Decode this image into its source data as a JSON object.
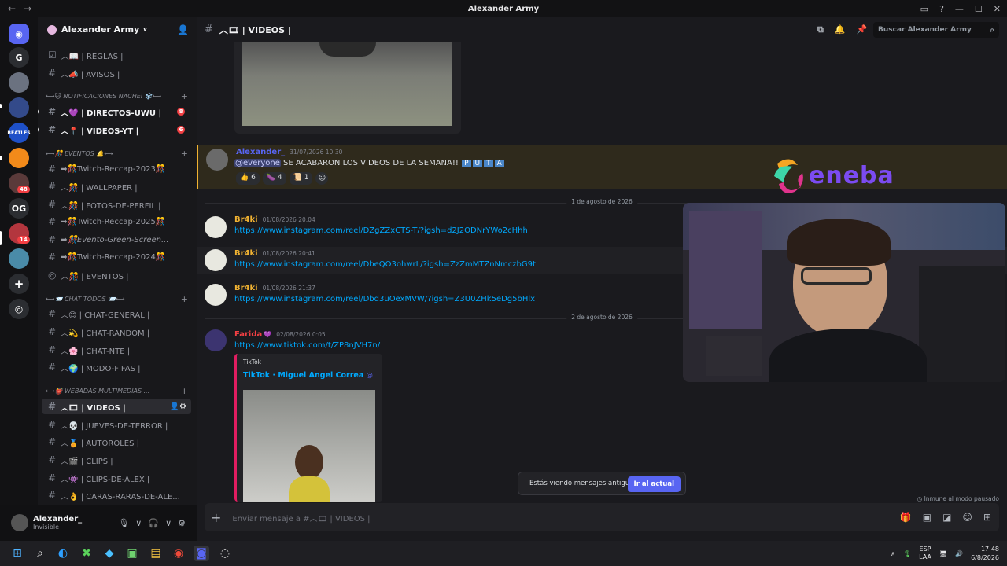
{
  "window": {
    "title": "Alexander Army"
  },
  "server": {
    "name": "Alexander Army"
  },
  "rail": {
    "servers": [
      {
        "name": "discord-home"
      },
      {
        "label": "G"
      },
      {
        "name": "server-a"
      },
      {
        "name": "server-b"
      },
      {
        "name": "beatles"
      },
      {
        "name": "server-c"
      },
      {
        "name": "server-d",
        "badge": "48"
      },
      {
        "label": "OG"
      },
      {
        "name": "server-e",
        "badge": "14"
      },
      {
        "name": "server-f"
      }
    ]
  },
  "sidebar": {
    "channels_top": [
      {
        "label": "︿📖 | REGLAS |"
      },
      {
        "label": "︿📣 | AVISOS |"
      }
    ],
    "cat_notif": "⟷🐱 NOTIFICACIONES NACHEI ❄️⟷",
    "notif_channels": [
      {
        "label": "︿💜 | DIRECTOS-UWU |",
        "mention": "8"
      },
      {
        "label": "︿📍 | VIDEOS-YT |",
        "mention": "6"
      }
    ],
    "cat_eventos": "⟷🎊 EVENTOS 🔔⟷",
    "eventos_channels": [
      {
        "label": "➡🎊Twitch-Reccap-2023🎊"
      },
      {
        "label": "︿🎊 | WALLPAPER |"
      },
      {
        "label": "︿🎊 | FOTOS-DE-PERFIL |"
      },
      {
        "label": "➡🎊Twitch-Reccap-2025🎊"
      },
      {
        "label": "➡🎊Evento-Green-Screen..."
      },
      {
        "label": "➡🎊Twitch-Reccap-2024🎊"
      },
      {
        "label": "︿🎊 | EVENTOS |"
      }
    ],
    "cat_chat": "⟷📨 CHAT TODOS 📨⟷",
    "chat_channels": [
      {
        "label": "︿😊 | CHAT-GENERAL |"
      },
      {
        "label": "︿💫 | CHAT-RANDOM |"
      },
      {
        "label": "︿🌸 | CHAT-NTE |"
      },
      {
        "label": "︿🌍 | MODO-FIFAS |"
      }
    ],
    "cat_webadas": "⟷👹 WEBADAS MULTIMEDIAS ...",
    "webadas_channels": [
      {
        "label": "︿🎞 | VIDEOS |"
      },
      {
        "label": "︿💀 | JUEVES-DE-TERROR |"
      },
      {
        "label": "︿🏅 | AUTOROLES |"
      },
      {
        "label": "︿🎬 | CLIPS |"
      },
      {
        "label": "︿👾 | CLIPS-DE-ALEX |"
      },
      {
        "label": "︿👌 | CARAS-RARAS-DE-ALE..."
      }
    ]
  },
  "user": {
    "name": "Alexander_",
    "status": "Invisible"
  },
  "channel": {
    "title": "︿🎞 | VIDEOS |"
  },
  "search": {
    "placeholder": "Buscar Alexander Army"
  },
  "messages": {
    "announce": {
      "author": "Alexander_",
      "time": "31/07/2026 10:30",
      "mention": "@everyone",
      "text": " SE ACABARON LOS VIDEOS DE LA SEMANA!!",
      "puta": [
        "P",
        "U",
        "T",
        "A"
      ],
      "reactions": [
        {
          "emoji": "👍",
          "count": "6"
        },
        {
          "emoji": "🍆",
          "count": "4"
        },
        {
          "emoji": "📜",
          "count": "1"
        }
      ]
    },
    "date1": "1 de agosto de 2026",
    "br1": {
      "author": "Br4ki",
      "time": "01/08/2026 20:04",
      "link": "https://www.instagram.com/reel/DZgZZxCTS-T/?igsh=d2J2ODNrYWo2cHhh"
    },
    "br2": {
      "author": "Br4ki",
      "time": "01/08/2026 20:41",
      "link": "https://www.instagram.com/reel/DbeQO3ohwrL/?igsh=ZzZmMTZnNmczbG9t"
    },
    "br3": {
      "author": "Br4ki",
      "time": "01/08/2026 21:37",
      "link": "https://www.instagram.com/reel/Dbd3uOexMVW/?igsh=Z3U0ZHk5eDg5bHlx"
    },
    "date2": "2 de agosto de 2026",
    "farida": {
      "author": "Farida",
      "time": "02/08/2026 0:05",
      "link": "https://www.tiktok.com/t/ZP8nJVH7n/",
      "embed_provider": "TikTok",
      "embed_title": "TikTok · Miguel Angel Correa"
    }
  },
  "banner": {
    "text": "Estás viendo mensajes antiguos",
    "button": "Ir al actual"
  },
  "immune": "Inmune al modo pausado",
  "composer": {
    "placeholder": "Enviar mensaje a #︿🎞 | VIDEOS |"
  },
  "sponsor": {
    "word": "eneba"
  },
  "tray": {
    "lang1": "ESP",
    "lang2": "LAA",
    "time": "17:48",
    "date": "6/8/2026"
  },
  "colors": {
    "accent": "#5865f2",
    "announce_bg": "#2f2a1c",
    "br4ki": "#f0b232",
    "alexander": "#5865f2",
    "farida": "#f23f43"
  }
}
